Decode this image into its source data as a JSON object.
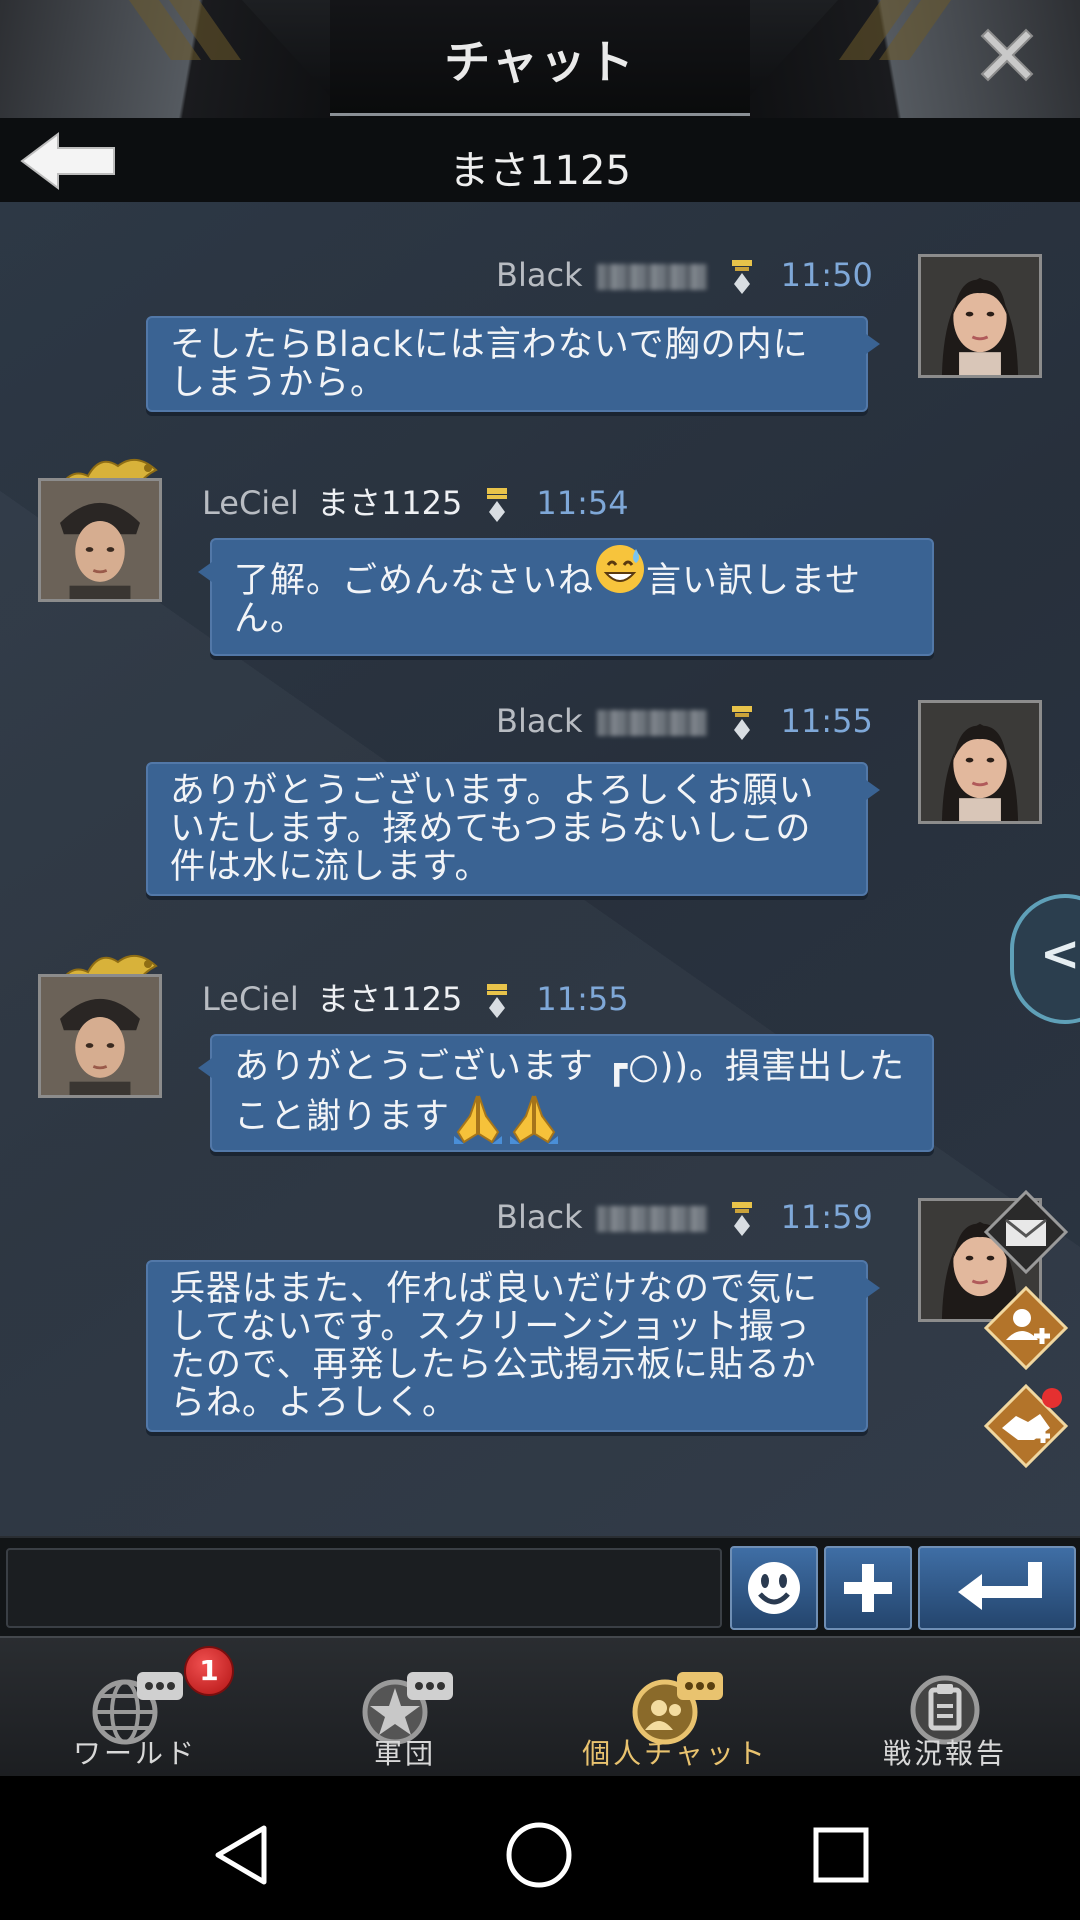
{
  "header": {
    "title": "チャット"
  },
  "subheader": {
    "title": "まさ1125"
  },
  "messages": [
    {
      "side": "right",
      "name": "Black",
      "time": "11:50",
      "text": "そしたらBlackには言わないで胸の内にしまうから。"
    },
    {
      "side": "left",
      "name": "LeCiel",
      "name2": "まさ1125",
      "time": "11:54",
      "text_a": "了解。ごめんなさいね",
      "emoji": "sweat-smile",
      "text_b": "言い訳しません。"
    },
    {
      "side": "right",
      "name": "Black",
      "time": "11:55",
      "text": "ありがとうございます。よろしくお願いいたします。揉めてもつまらないしこの件は水に流します。"
    },
    {
      "side": "left",
      "name": "LeCiel",
      "name2": "まさ1125",
      "time": "11:55",
      "text_a": "ありがとうございます ┏○))。損害出したこと謝ります",
      "emoji": "folded-hands x2"
    },
    {
      "side": "right",
      "name": "Black",
      "time": "11:59",
      "text": "兵器はまた、作れば良いだけなので気にしてないです。スクリーンショット撮ったので、再発したら公式掲示板に貼るからね。よろしく。"
    }
  ],
  "side": {
    "toggle": "<<"
  },
  "tabs": [
    {
      "label": "ワールド",
      "badge": "1",
      "icon": "globe-chat-icon"
    },
    {
      "label": "軍団",
      "icon": "star-chat-icon"
    },
    {
      "label": "個人チャット",
      "icon": "person-chat-icon",
      "active": true
    },
    {
      "label": "戦況報告",
      "icon": "report-icon"
    }
  ],
  "colors": {
    "bubble": "#3a6393",
    "time": "#7fa8d8",
    "active_tab": "#e9c36f",
    "badge": "#d32020"
  }
}
